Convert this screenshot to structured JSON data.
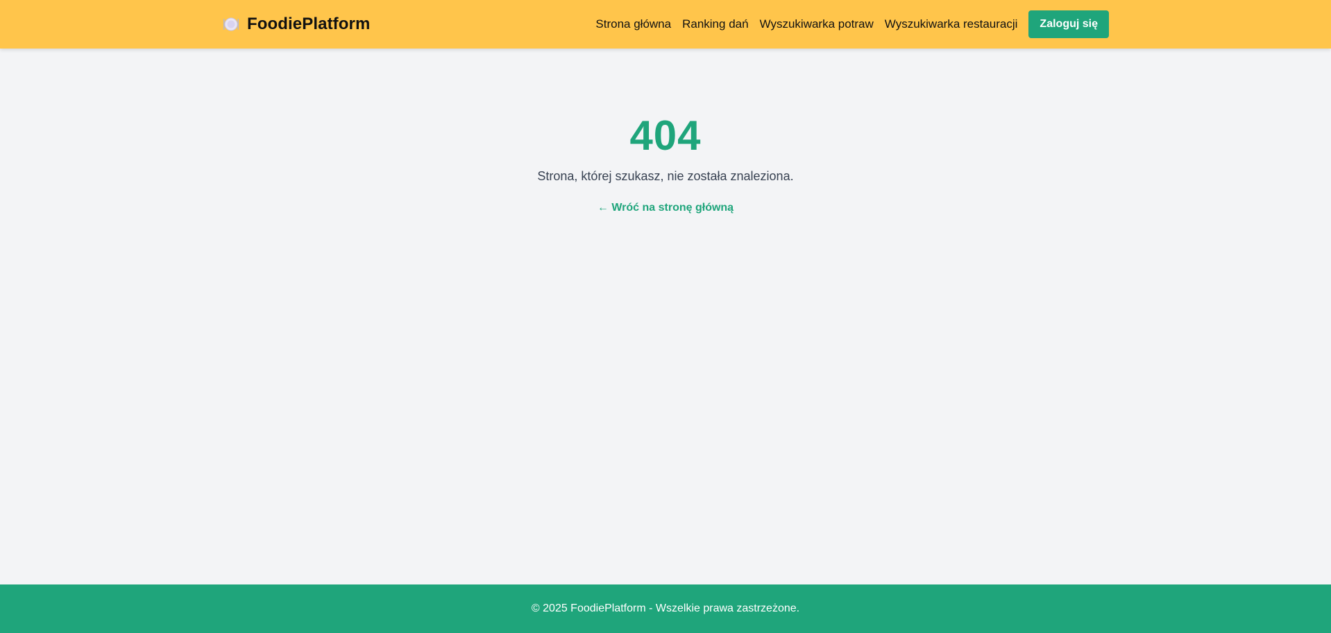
{
  "header": {
    "brand_icon": "plate-icon",
    "brand_name": "FoodiePlatform",
    "nav": [
      {
        "label": "Strona główna"
      },
      {
        "label": "Ranking dań"
      },
      {
        "label": "Wyszukiwarka potraw"
      },
      {
        "label": "Wyszukiwarka restauracji"
      }
    ],
    "login_label": "Zaloguj się"
  },
  "error": {
    "code": "404",
    "message": "Strona, której szukasz, nie została znaleziona.",
    "home_link": "← Wróć na stronę główną"
  },
  "footer": {
    "text": "© 2025 FoodiePlatform - Wszelkie prawa zastrzeżone."
  },
  "colors": {
    "header_bg": "#ffc54b",
    "accent": "#1fa57b",
    "page_bg": "#f3f4f6"
  }
}
